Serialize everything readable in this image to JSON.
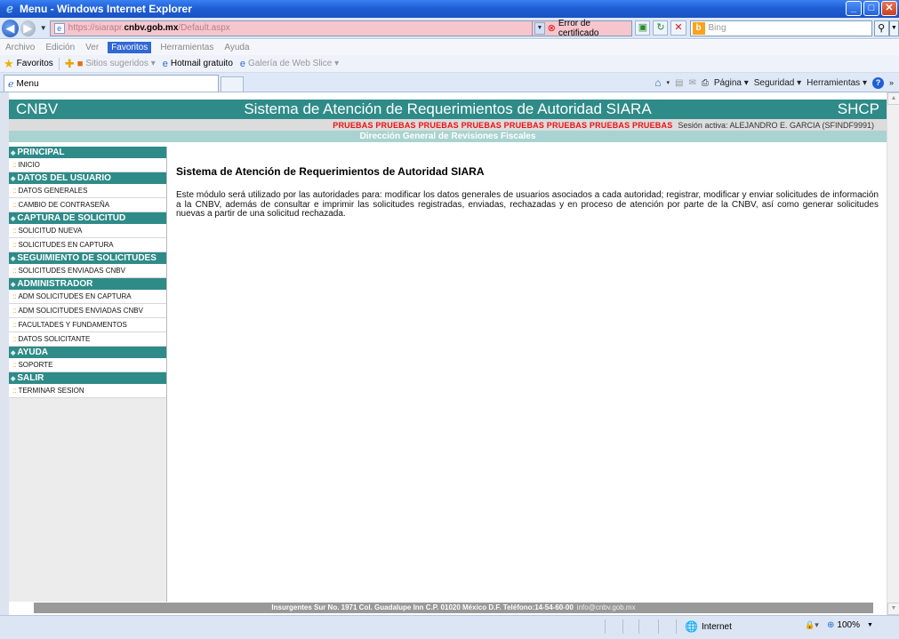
{
  "browser": {
    "title": "Menu - Windows Internet Explorer",
    "url_prefix": "https://siarapr.",
    "url_domain": "cnbv.gob.mx",
    "url_suffix": "/Default.aspx",
    "cert_error": "Error de certificado",
    "search_placeholder": "Bing",
    "menu": [
      "Archivo",
      "Edición",
      "Ver",
      "Favoritos",
      "Herramientas",
      "Ayuda"
    ],
    "favorites_label": "Favoritos",
    "fav_items": [
      "Sitios sugeridos ▾",
      "Hotmail gratuito",
      "Galería de Web Slice ▾"
    ],
    "tab_label": "Menu",
    "cmd": {
      "page": "Página ▾",
      "security": "Seguridad ▾",
      "tools": "Herramientas ▾"
    },
    "status_zone": "Internet",
    "zoom": "100%"
  },
  "site": {
    "left_title": "CNBV",
    "center_title": "Sistema de Atención de Requerimientos de Autoridad SIARA",
    "right_title": "SHCP",
    "pruebas": "PRUEBAS PRUEBAS PRUEBAS PRUEBAS PRUEBAS PRUEBAS PRUEBAS PRUEBAS",
    "session": "Sesión activa: ALEJANDRO E. GARCIA (SFINDF9991)",
    "direction": "Dirección General de Revisiones Fiscales"
  },
  "sidebar": [
    {
      "title": "PRINCIPAL",
      "items": [
        "INICIO"
      ]
    },
    {
      "title": "DATOS DEL USUARIO",
      "items": [
        "DATOS GENERALES",
        "CAMBIO DE CONTRASEÑA"
      ]
    },
    {
      "title": "CAPTURA DE SOLICITUD",
      "items": [
        "SOLICITUD NUEVA",
        "SOLICITUDES EN CAPTURA"
      ]
    },
    {
      "title": "SEGUIMIENTO DE SOLICITUDES",
      "items": [
        "SOLICITUDES ENVIADAS CNBV"
      ]
    },
    {
      "title": "ADMINISTRADOR",
      "items": [
        "ADM SOLICITUDES EN CAPTURA",
        "ADM SOLICITUDES ENVIADAS CNBV",
        "FACULTADES Y FUNDAMENTOS",
        "DATOS SOLICITANTE"
      ]
    },
    {
      "title": "AYUDA",
      "items": [
        "SOPORTE"
      ]
    },
    {
      "title": "SALIR",
      "items": [
        "TERMINAR SESION"
      ]
    }
  ],
  "main": {
    "heading": "Sistema de Atención de Requerimientos de Autoridad SIARA",
    "body": "Este módulo será utilizado por las autoridades para: modificar los datos generales de usuarios asociados a cada autoridad; registrar, modificar y enviar solicitudes de información a la CNBV, además de consultar e imprimir las solicitudes registradas, enviadas, rechazadas y en proceso de atención por parte de la CNBV, así como generar solicitudes nuevas a partir de una solicitud rechazada."
  },
  "footer": {
    "address": "Insurgentes Sur No. 1971  Col. Guadalupe Inn  C.P. 01020  México D.F.  Teléfono:14-54-60-00",
    "email": "info@cnbv.gob.mx"
  }
}
